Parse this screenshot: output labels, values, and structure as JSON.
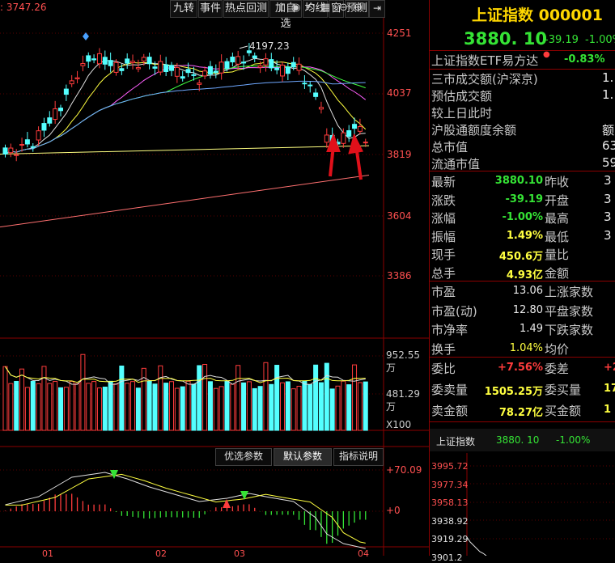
{
  "toolbar": {
    "prev_value": ": 3747.26",
    "buttons": [
      "九转",
      "事件",
      "热点回测",
      "加自选",
      "均线",
      "窗",
      "预测"
    ]
  },
  "price_axis": [
    "4251",
    "4037",
    "3819",
    "3604",
    "3386"
  ],
  "annotations": {
    "high_label": "4197.23"
  },
  "volume_axis": [
    "952.55万",
    "481.29万",
    "X100"
  ],
  "macd_axis": [
    "+70.09",
    "+0"
  ],
  "macd_params": [
    "优选参数",
    "默认参数",
    "指标说明"
  ],
  "time_axis": [
    "01",
    "02",
    "03",
    "04"
  ],
  "panel": {
    "title": "上证指数 000001",
    "price": "3880. 10",
    "change": "-39.19",
    "change_pct": "-1.00%",
    "etf_label": "上证指数ETF易方达",
    "etf_pct": "-0.83%",
    "misc": [
      {
        "label": "三市成交额(沪深京)",
        "value": "1."
      },
      {
        "label": "预估成交额",
        "value": "1."
      },
      {
        "label": "较上日此时",
        "value": ""
      },
      {
        "label": "沪股通额度余额",
        "value": "额"
      },
      {
        "label": "总市值",
        "value": "63."
      },
      {
        "label": "流通市值",
        "value": "59."
      }
    ],
    "quote": [
      {
        "l1": "最新",
        "v1": "3880.10",
        "c1": "green",
        "l2": "昨收",
        "v2": "3"
      },
      {
        "l1": "涨跌",
        "v1": "-39.19",
        "c1": "green",
        "l2": "开盘",
        "v2": "3"
      },
      {
        "l1": "涨幅",
        "v1": "-1.00%",
        "c1": "green",
        "l2": "最高",
        "v2": "3"
      },
      {
        "l1": "振幅",
        "v1": "1.49%",
        "c1": "yel",
        "l2": "最低",
        "v2": "3"
      },
      {
        "l1": "现手",
        "v1": "450.6万",
        "c1": "yel",
        "l2": "量比",
        "v2": ""
      },
      {
        "l1": "总手",
        "v1": "4.93亿",
        "c1": "yel",
        "l2": "金额",
        "v2": ""
      }
    ],
    "stats": [
      {
        "l1": "市盈",
        "v1": "13.06",
        "l2": "上涨家数"
      },
      {
        "l1": "市盈(动)",
        "v1": "12.80",
        "l2": "平盘家数"
      },
      {
        "l1": "市净率",
        "v1": "1.49",
        "l2": "下跌家数"
      },
      {
        "l1": "换手",
        "v1": "1.04%",
        "l2": "均价"
      }
    ],
    "order": [
      {
        "l1": "委比",
        "v1": "+7.56%",
        "c1": "red",
        "l2": "委差",
        "v2": "+2",
        "c2": "red"
      },
      {
        "l1": "委卖量",
        "v1": "1505.25万",
        "c1": "yel",
        "l2": "委买量",
        "v2": "17",
        "c2": "yel"
      },
      {
        "l1": "卖金额",
        "v1": "78.27亿",
        "c1": "yel",
        "l2": "买金额",
        "v2": "1",
        "c2": "yel"
      }
    ],
    "mini": {
      "name": "上证指数",
      "price": "3880. 10",
      "pct": "-1.00%",
      "axis": [
        "3995.72",
        "3977.34",
        "3958.13",
        "3938.92",
        "3919.29",
        "3901.2"
      ]
    }
  },
  "colors": {
    "up": "#ff3c3c",
    "down": "#54ffff",
    "grid": "#8b0000"
  }
}
